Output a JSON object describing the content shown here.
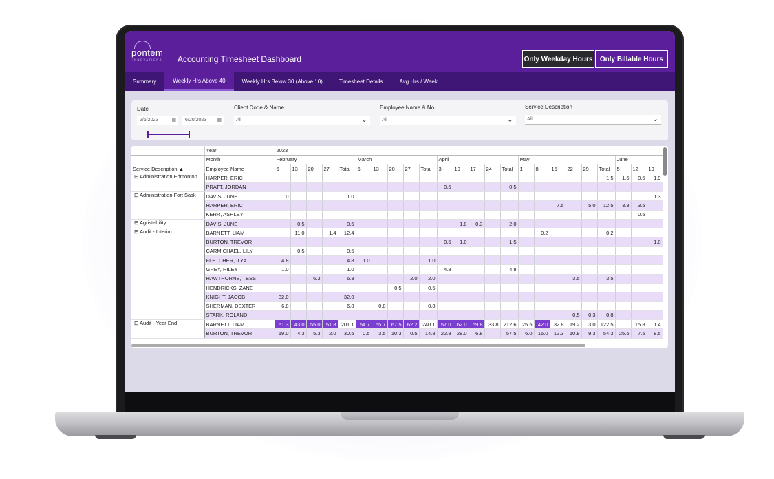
{
  "app": {
    "title": "Accounting Timesheet Dashboard",
    "logo": "pontem",
    "logo_sub": "INNOVATIONS",
    "buttons": {
      "weekday": "Only Weekday Hours",
      "billable": "Only Billable Hours"
    }
  },
  "tabs": [
    "Summary",
    "Weekly Hrs Above 40",
    "Weekly Hrs Below 30 (Above 10)",
    "Timesheet Details",
    "Avg Hrs / Week"
  ],
  "filters": {
    "date_label": "Date",
    "date_start": "2/6/2023",
    "date_end": "6/20/2023",
    "client_label": "Client Code & Name",
    "client_value": "All",
    "employee_label": "Employee Name & No.",
    "employee_value": "All",
    "service_label": "Service Description",
    "service_value": "All"
  },
  "matrix": {
    "year_label": "Year",
    "year": "2023",
    "month_label": "Month",
    "svc_header": "Service Description",
    "emp_header": "Employee Name",
    "total": "Total",
    "months": [
      {
        "name": "February",
        "days": [
          "6",
          "13",
          "20",
          "27"
        ]
      },
      {
        "name": "March",
        "days": [
          "6",
          "13",
          "20",
          "27"
        ]
      },
      {
        "name": "April",
        "days": [
          "3",
          "10",
          "17",
          "24"
        ]
      },
      {
        "name": "May",
        "days": [
          "1",
          "8",
          "15",
          "22",
          "29"
        ]
      },
      {
        "name": "June",
        "days": [
          "5",
          "12",
          "19"
        ]
      }
    ],
    "rows": [
      [
        "Administration Edmonton",
        "HARPER, ERIC",
        [
          "",
          "",
          "",
          "",
          "",
          "",
          "",
          "",
          "",
          "",
          "",
          "",
          "",
          "",
          "",
          "",
          "",
          "",
          "",
          "",
          "1.5",
          "1.5",
          "0.5",
          "1.9",
          "1.9"
        ]
      ],
      [
        "",
        "PRATT, JORDAN",
        [
          "",
          "",
          "",
          "",
          "",
          "",
          "",
          "",
          "",
          "",
          "0.5",
          "",
          "",
          "",
          "0.5",
          "",
          "",
          "",
          "",
          "",
          "",
          ""
        ]
      ],
      [
        "Administration Fort Sask",
        "DAVIS, JUNE",
        [
          "1.0",
          "",
          "",
          "",
          "1.0",
          "",
          "",
          "",
          "",
          "",
          "",
          "",
          "",
          "",
          "",
          "",
          "",
          "",
          "",
          "",
          "",
          "",
          "",
          "1.3",
          ""
        ]
      ],
      [
        "",
        "HARPER, ERIC",
        [
          "",
          "",
          "",
          "",
          "",
          "",
          "",
          "",
          "",
          "",
          "",
          "",
          "",
          "",
          "",
          "",
          "",
          "7.5",
          "",
          "5.0",
          "12.5",
          "3.8",
          "3.5",
          ""
        ]
      ],
      [
        "",
        "KERR, ASHLEY",
        [
          "",
          "",
          "",
          "",
          "",
          "",
          "",
          "",
          "",
          "",
          "",
          "",
          "",
          "",
          "",
          "",
          "",
          "",
          "",
          "",
          "",
          "",
          "0.5",
          "",
          ""
        ]
      ],
      [
        "Agristability",
        "DAVIS, JUNE",
        [
          "",
          "0.5",
          "",
          "",
          "0.5",
          "",
          "",
          "",
          "",
          "",
          "",
          "1.8",
          "0.3",
          "",
          "2.0",
          "",
          "",
          "",
          "",
          "",
          "",
          "",
          "",
          ""
        ]
      ],
      [
        "Audit - Interim",
        "BARNETT, LIAM",
        [
          "",
          "11.0",
          "",
          "1.4",
          "12.4",
          "",
          "",
          "",
          "",
          "",
          "",
          "",
          "",
          "",
          "",
          "",
          "0.2",
          "",
          "",
          "",
          "0.2",
          "",
          "",
          ""
        ]
      ],
      [
        "",
        "BURTON, TREVOR",
        [
          "",
          "",
          "",
          "",
          "",
          "",
          "",
          "",
          "",
          "",
          "0.5",
          "1.0",
          "",
          "",
          "1.5",
          "",
          "",
          "",
          "",
          "",
          "",
          "",
          "",
          "1.0"
        ]
      ],
      [
        "",
        "CARMICHAEL, LILY",
        [
          "",
          "0.5",
          "",
          "",
          "0.5",
          "",
          "",
          "",
          "",
          "",
          "",
          "",
          "",
          "",
          "",
          "",
          "",
          "",
          "",
          "",
          "",
          "",
          "",
          ""
        ]
      ],
      [
        "",
        "FLETCHER, ILYA",
        [
          "4.8",
          "",
          "",
          "",
          "4.8",
          "1.0",
          "",
          "",
          "",
          "1.0",
          "",
          "",
          "",
          "",
          "",
          "",
          "",
          "",
          "",
          "",
          "",
          "",
          "",
          ""
        ]
      ],
      [
        "",
        "GREY, RILEY",
        [
          "1.0",
          "",
          "",
          "",
          "1.0",
          "",
          "",
          "",
          "",
          "",
          "4.8",
          "",
          "",
          "",
          "4.8",
          "",
          "",
          "",
          "",
          "",
          "",
          "",
          "",
          ""
        ]
      ],
      [
        "",
        "HAWTHORNE, TESS",
        [
          "",
          "",
          "6.3",
          "",
          "6.3",
          "",
          "",
          "",
          "2.0",
          "2.0",
          "",
          "",
          "",
          "",
          "",
          "",
          "",
          "",
          "3.5",
          "",
          "3.5",
          "",
          "",
          ""
        ]
      ],
      [
        "",
        "HENDRICKS, ZANE",
        [
          "",
          "",
          "",
          "",
          "",
          "",
          "",
          "0.5",
          "",
          "0.5",
          "",
          "",
          "",
          "",
          "",
          "",
          "",
          "",
          "",
          "",
          "",
          "",
          "",
          ""
        ]
      ],
      [
        "",
        "KNIGHT, JACOB",
        [
          "32.0",
          "",
          "",
          "",
          "32.0",
          "",
          "",
          "",
          "",
          "",
          "",
          "",
          "",
          "",
          "",
          "",
          "",
          "",
          "",
          "",
          "",
          "",
          "",
          ""
        ]
      ],
      [
        "",
        "SHERMAN, DEXTER",
        [
          "6.8",
          "",
          "",
          "",
          "6.8",
          "",
          "0.8",
          "",
          "",
          "0.8",
          "",
          "",
          "",
          "",
          "",
          "",
          "",
          "",
          "",
          "",
          "",
          "",
          "",
          ""
        ]
      ],
      [
        "",
        "STARK, ROLAND",
        [
          "",
          "",
          "",
          "",
          "",
          "",
          "",
          "",
          "",
          "",
          "",
          "",
          "",
          "",
          "",
          "",
          "",
          "",
          "0.5",
          "0.3",
          "0.8",
          "",
          "",
          ""
        ]
      ],
      [
        "Audit - Year End",
        "BARNETT, LIAM",
        [
          "51.3",
          "43.0",
          "55.0",
          "51.8",
          "201.1",
          "54.7",
          "55.7",
          "67.5",
          "62.2",
          "240.1",
          "57.0",
          "62.0",
          "59.8",
          "33.8",
          "212.6",
          "25.5",
          "42.0",
          "32.8",
          "19.2",
          "3.0",
          "122.5",
          "",
          "15.8",
          "1.4"
        ]
      ],
      [
        "",
        "BURTON, TREVOR",
        [
          "19.0",
          "4.3",
          "5.3",
          "2.0",
          "30.5",
          "0.5",
          "3.5",
          "10.3",
          "0.5",
          "14.8",
          "22.8",
          "28.0",
          "6.8",
          "",
          "57.5",
          "6.0",
          "16.0",
          "12.3",
          "10.8",
          "9.3",
          "54.3",
          "25.5",
          "7.5",
          "8.5"
        ]
      ]
    ]
  }
}
